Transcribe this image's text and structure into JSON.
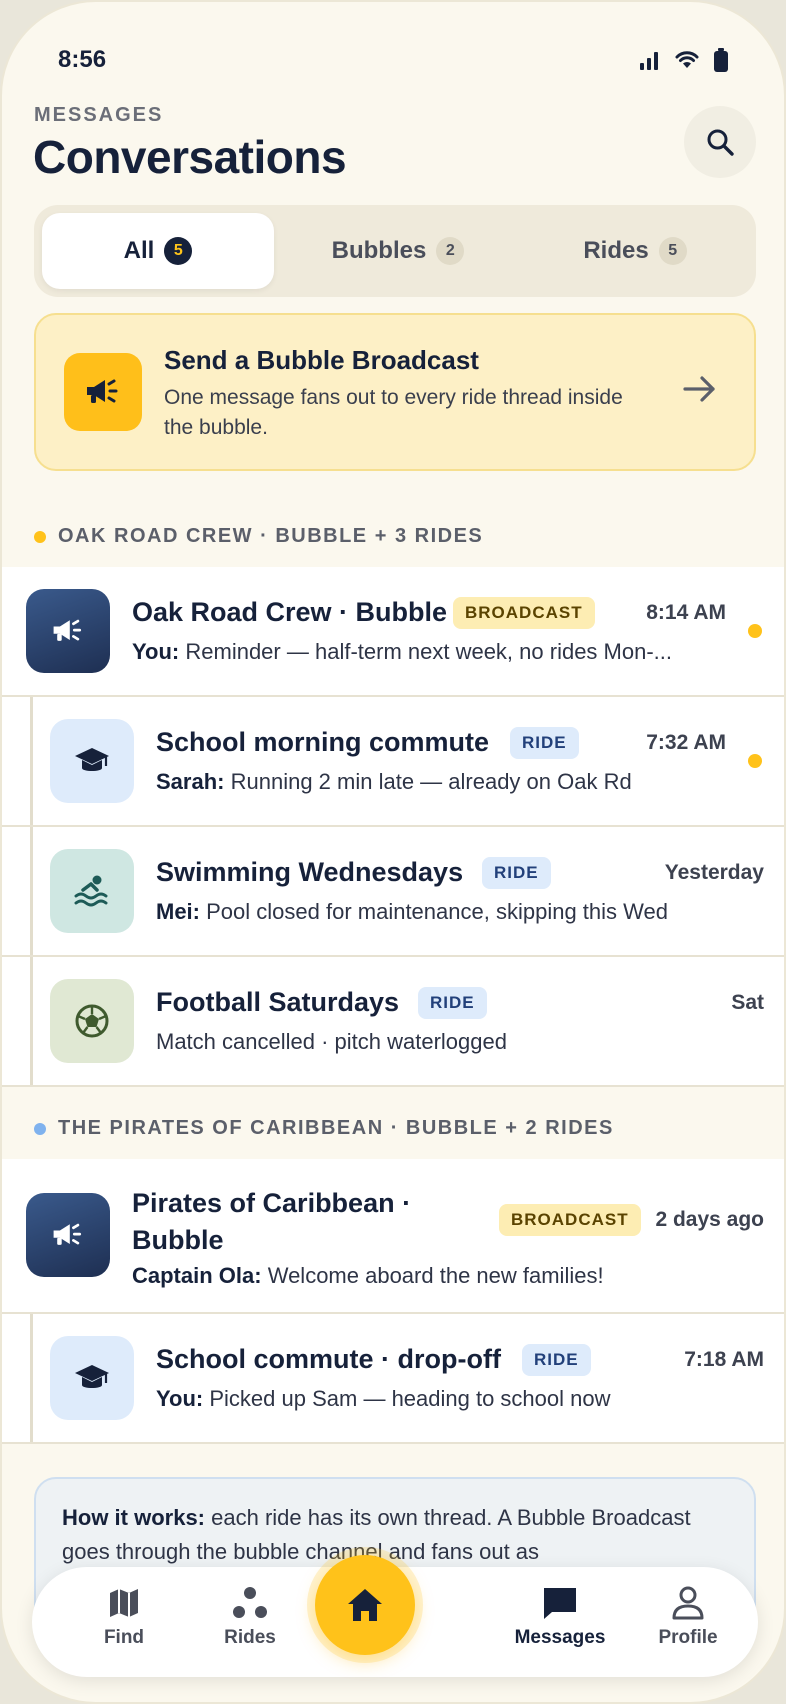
{
  "status_bar": {
    "time": "8:56"
  },
  "header": {
    "eyebrow": "MESSAGES",
    "title": "Conversations"
  },
  "tabs": [
    {
      "label": "All",
      "count": "5",
      "active": true
    },
    {
      "label": "Bubbles",
      "count": "2"
    },
    {
      "label": "Rides",
      "count": "5"
    }
  ],
  "broadcast_card": {
    "title": "Send a Bubble Broadcast",
    "description": "One message fans out to every ride thread inside the bubble."
  },
  "groups": [
    {
      "header": "OAK ROAD CREW · BUBBLE + 3 RIDES",
      "dot_color": "#ffc21a",
      "rows": [
        {
          "name": "Oak Road Crew · Bubble",
          "badge": "BROADCAST",
          "time": "8:14 AM",
          "sender": "You:",
          "message": "Reminder — half-term next week, no rides Mon-...",
          "unread": true
        },
        {
          "name": "School morning commute",
          "badge": "RIDE",
          "time": "7:32 AM",
          "sender": "Sarah:",
          "message": "Running 2 min late — already on Oak Rd",
          "unread": true
        },
        {
          "name": "Swimming Wednesdays",
          "badge": "RIDE",
          "time": "Yesterday",
          "sender": "Mei:",
          "message": "Pool closed for maintenance, skipping this Wed"
        },
        {
          "name": "Football Saturdays",
          "badge": "RIDE",
          "time": "Sat",
          "sender": "",
          "message": "Match cancelled · pitch waterlogged"
        }
      ]
    },
    {
      "header": "THE PIRATES OF CARIBBEAN · BUBBLE + 2 RIDES",
      "dot_color": "#7fb2ee",
      "rows": [
        {
          "name_line1": "Pirates of Caribbean ·",
          "name_line2": "Bubble",
          "badge": "BROADCAST",
          "time": "2 days ago",
          "sender": "Captain Ola:",
          "message": "Welcome aboard the new families!"
        },
        {
          "name": "School commute · drop-off",
          "badge": "RIDE",
          "time": "7:18 AM",
          "sender": "You:",
          "message": "Picked up Sam — heading to school now"
        }
      ]
    }
  ],
  "info": {
    "lead": "How it works:",
    "text": "each ride has its own thread. A Bubble Broadcast goes through the bubble channel and fans out as"
  },
  "nav": {
    "items": [
      {
        "label": "Find",
        "icon": "map-icon"
      },
      {
        "label": "Rides",
        "icon": "rides-icon"
      },
      {
        "label": "Messages",
        "icon": "chat-icon",
        "active": true
      },
      {
        "label": "Profile",
        "icon": "person-icon"
      }
    ],
    "home_icon": "home-icon"
  },
  "colors": {
    "accent": "#ffc21a",
    "navy": "#16213a",
    "background": "#fbf8ee"
  }
}
